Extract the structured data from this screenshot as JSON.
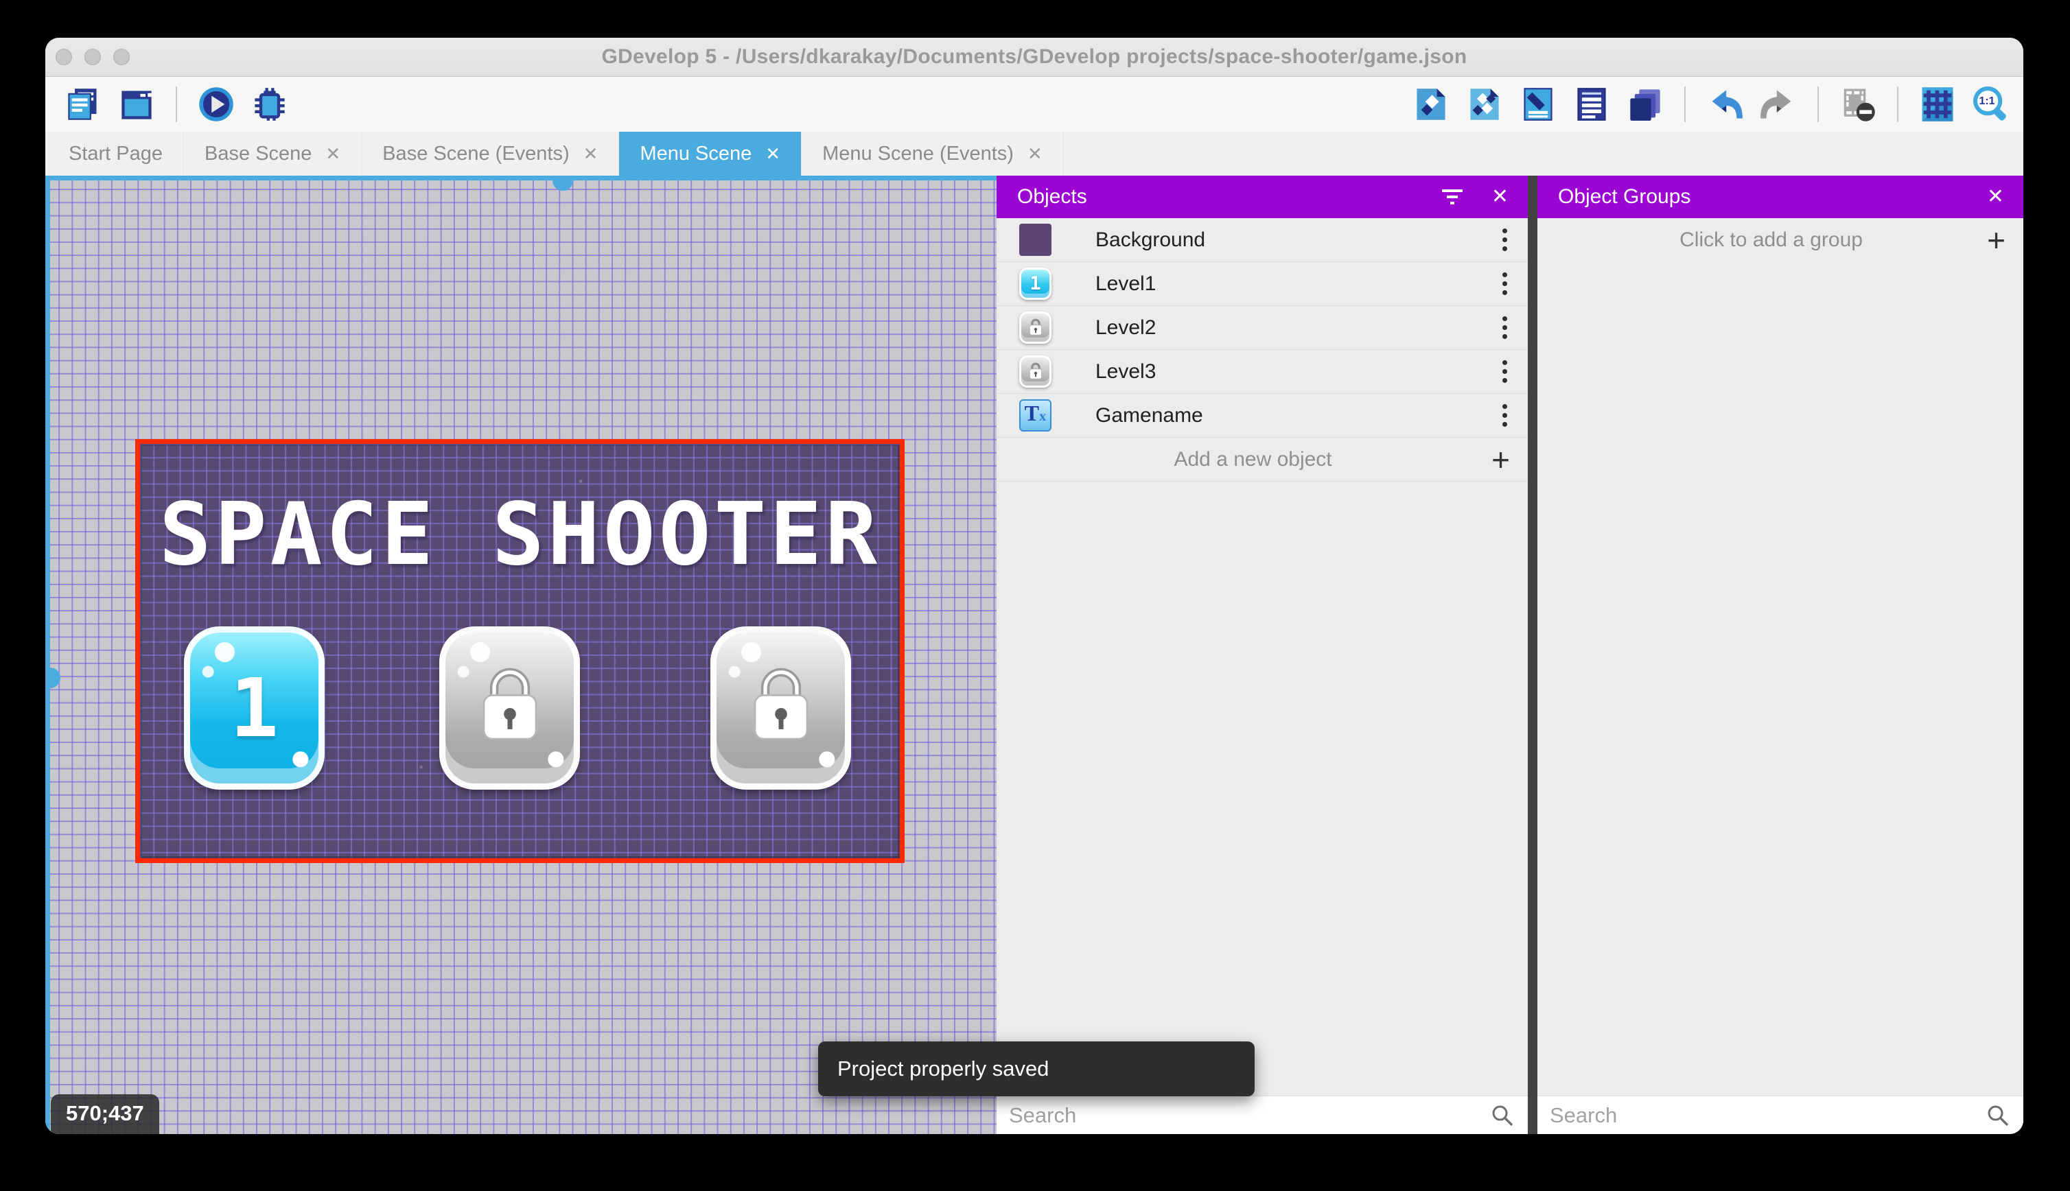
{
  "window": {
    "title": "GDevelop 5 - /Users/dkarakay/Documents/GDevelop projects/space-shooter/game.json",
    "traffic_lights": [
      "close",
      "minimize",
      "zoom"
    ]
  },
  "toolbar": {
    "left_icons": [
      "project-manager",
      "scene-list",
      "play-preview",
      "debug"
    ],
    "right_icons": [
      "objects-editor",
      "object-groups-editor",
      "properties",
      "instances-list",
      "layers",
      "undo",
      "redo",
      "toggle-window-mask",
      "toggle-grid",
      "zoom-one-to-one"
    ],
    "zoom_ratio_label": "1:1"
  },
  "tabs": [
    {
      "label": "Start Page",
      "active": false,
      "closable": false
    },
    {
      "label": "Base Scene",
      "active": false,
      "closable": true
    },
    {
      "label": "Base Scene (Events)",
      "active": false,
      "closable": true
    },
    {
      "label": "Menu Scene",
      "active": true,
      "closable": true
    },
    {
      "label": "Menu Scene (Events)",
      "active": false,
      "closable": true
    }
  ],
  "icons": {
    "close_glyph": "✕",
    "plus_glyph": "+"
  },
  "canvas": {
    "coordinates_label": "570;437",
    "scene": {
      "title": "SPACE SHOOTER",
      "buttons": [
        {
          "id": "level1",
          "glyph": "1",
          "state": "unlocked"
        },
        {
          "id": "level2",
          "state": "locked"
        },
        {
          "id": "level3",
          "state": "locked"
        }
      ]
    }
  },
  "objects_panel": {
    "title": "Objects",
    "items": [
      {
        "name": "Background",
        "thumb": "background"
      },
      {
        "name": "Level1",
        "thumb": "cyan-button",
        "thumb_glyph": "1"
      },
      {
        "name": "Level2",
        "thumb": "locked-button"
      },
      {
        "name": "Level3",
        "thumb": "locked-button"
      },
      {
        "name": "Gamename",
        "thumb": "text-object",
        "thumb_chars": [
          "T",
          "x"
        ]
      }
    ],
    "add_label": "Add a new object",
    "search_placeholder": "Search"
  },
  "object_groups_panel": {
    "title": "Object Groups",
    "empty_label": "Click to add a group",
    "search_placeholder": "Search"
  },
  "toast": {
    "message": "Project properly saved"
  },
  "colors": {
    "accent_blue": "#49abde",
    "panel_purple": "#9c06d2",
    "selection_red": "#ff2b00",
    "scene_background": "#57496f"
  }
}
